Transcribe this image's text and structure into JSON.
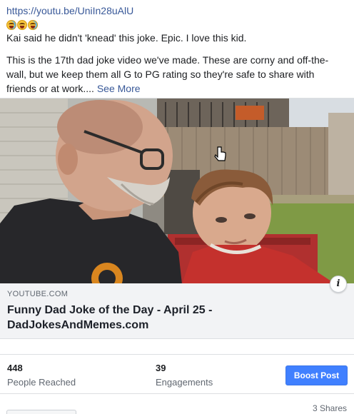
{
  "post": {
    "link": "https://youtu.be/UniIn28uAlU",
    "emojis": [
      "rofl-emoji",
      "grin-sweat-emoji",
      "laughing-emoji"
    ],
    "caption": "Kai said he didn't 'knead' this joke. Epic. I love this kid.",
    "body_line1": "This is the 17th dad joke video we've made. These are corny and off-the-",
    "body_line2": "wall, but we keep them all G to PG rating so they're safe to share with",
    "body_line3": "friends or at work....",
    "see_more": "See More"
  },
  "link_card": {
    "domain": "YOUTUBE.COM",
    "title_line1": "Funny Dad Joke of the Day - April 25 -",
    "title_line2": "DadJokesAndMemes.com",
    "info_label": "i"
  },
  "stats": {
    "reached_value": "448",
    "reached_label": "People Reached",
    "engagements_value": "39",
    "engagements_label": "Engagements"
  },
  "boost_label": "Boost Post",
  "shares": "3 Shares",
  "colors": {
    "link": "#385898",
    "boost": "#4080ff",
    "card_bg": "#f2f3f5"
  }
}
